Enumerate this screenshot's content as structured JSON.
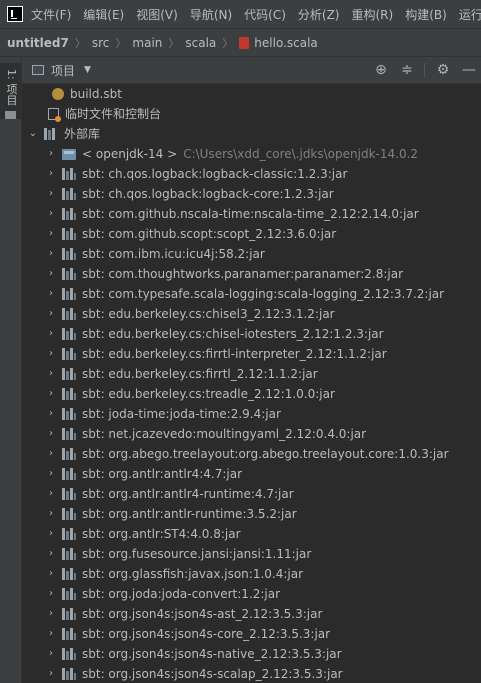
{
  "colors": {
    "background": "#2b2b2b",
    "chrome": "#3c3f41",
    "text": "#bbbbbb",
    "muted": "#808080"
  },
  "menubar": {
    "items": [
      "文件(F)",
      "编辑(E)",
      "视图(V)",
      "导航(N)",
      "代码(C)",
      "分析(Z)",
      "重构(R)",
      "构建(B)",
      "运行(U)"
    ]
  },
  "breadcrumb": {
    "items": [
      "untitled7",
      "src",
      "main",
      "scala",
      "hello.scala"
    ]
  },
  "side_strip": {
    "tab_label": "1: 项目"
  },
  "panel": {
    "title": "项目"
  },
  "tree": {
    "build_sbt": "build.sbt",
    "scratches": "临时文件和控制台",
    "external_libraries": "外部库",
    "jdk": {
      "name": "< openjdk-14 >",
      "path": "C:\\Users\\xdd_core\\.jdks\\openjdk-14.0.2"
    },
    "libraries": [
      "sbt: ch.qos.logback:logback-classic:1.2.3:jar",
      "sbt: ch.qos.logback:logback-core:1.2.3:jar",
      "sbt: com.github.nscala-time:nscala-time_2.12:2.14.0:jar",
      "sbt: com.github.scopt:scopt_2.12:3.6.0:jar",
      "sbt: com.ibm.icu:icu4j:58.2:jar",
      "sbt: com.thoughtworks.paranamer:paranamer:2.8:jar",
      "sbt: com.typesafe.scala-logging:scala-logging_2.12:3.7.2:jar",
      "sbt: edu.berkeley.cs:chisel3_2.12:3.1.2:jar",
      "sbt: edu.berkeley.cs:chisel-iotesters_2.12:1.2.3:jar",
      "sbt: edu.berkeley.cs:firrtl-interpreter_2.12:1.1.2:jar",
      "sbt: edu.berkeley.cs:firrtl_2.12:1.1.2:jar",
      "sbt: edu.berkeley.cs:treadle_2.12:1.0.0:jar",
      "sbt: joda-time:joda-time:2.9.4:jar",
      "sbt: net.jcazevedo:moultingyaml_2.12:0.4.0:jar",
      "sbt: org.abego.treelayout:org.abego.treelayout.core:1.0.3:jar",
      "sbt: org.antlr:antlr4:4.7:jar",
      "sbt: org.antlr:antlr4-runtime:4.7:jar",
      "sbt: org.antlr:antlr-runtime:3.5.2:jar",
      "sbt: org.antlr:ST4:4.0.8:jar",
      "sbt: org.fusesource.jansi:jansi:1.11:jar",
      "sbt: org.glassfish:javax.json:1.0.4:jar",
      "sbt: org.joda:joda-convert:1.2:jar",
      "sbt: org.json4s:json4s-ast_2.12:3.5.3:jar",
      "sbt: org.json4s:json4s-core_2.12:3.5.3:jar",
      "sbt: org.json4s:json4s-native_2.12:3.5.3:jar",
      "sbt: org.json4s:json4s-scalap_2.12:3.5.3:jar"
    ]
  }
}
